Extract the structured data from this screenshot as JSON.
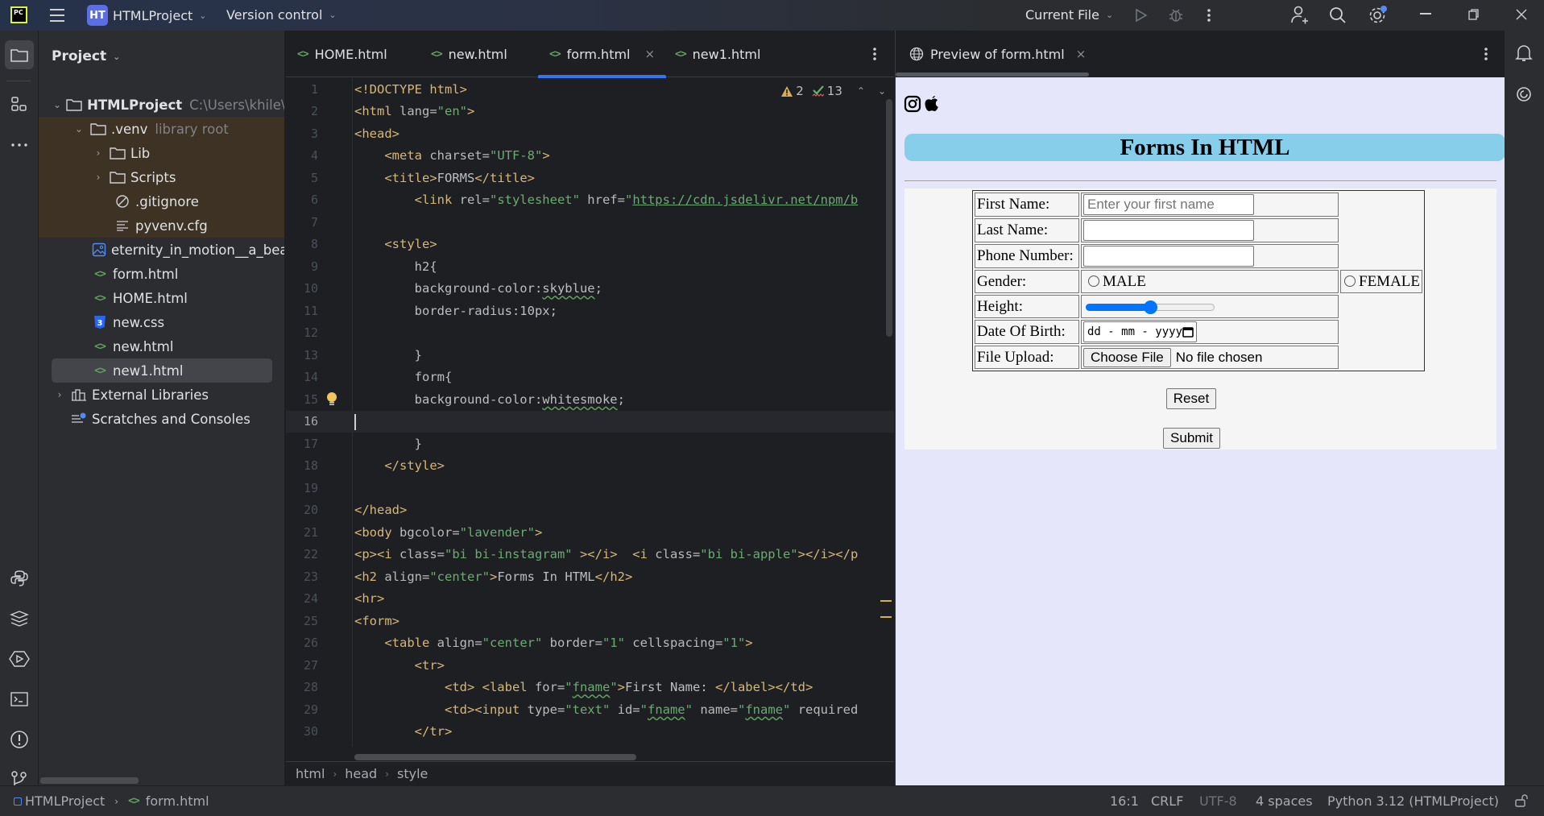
{
  "titlebar": {
    "app_logo": "PC",
    "project_badge": "HT",
    "project_name": "HTMLProject",
    "vcs_label": "Version control",
    "run_config": "Current File",
    "icons": [
      "main-menu-icon",
      "run-icon",
      "debug-icon",
      "more-icon",
      "add-user-icon",
      "search-icon",
      "settings-icon",
      "minimize-icon",
      "restore-icon",
      "close-icon"
    ]
  },
  "left_strip": {
    "top": [
      "folder-icon",
      "structure-icon",
      "more-icon"
    ],
    "bottom": [
      "python-console-icon",
      "layers-icon",
      "services-icon",
      "terminal-icon",
      "problems-icon",
      "git-icon"
    ]
  },
  "project_panel": {
    "title": "Project",
    "tree": [
      {
        "label": "HTMLProject",
        "hint": "C:\\Users\\khile\\F",
        "type": "folder",
        "expanded": true
      },
      {
        "label": ".venv",
        "hint": "library root",
        "type": "folder",
        "expanded": true
      },
      {
        "label": "Lib",
        "type": "folder",
        "expanded": false
      },
      {
        "label": "Scripts",
        "type": "folder",
        "expanded": false
      },
      {
        "label": ".gitignore",
        "type": "ignore"
      },
      {
        "label": "pyvenv.cfg",
        "type": "text"
      },
      {
        "label": "eternity_in_motion__a_beach",
        "type": "image"
      },
      {
        "label": "form.html",
        "type": "html"
      },
      {
        "label": "HOME.html",
        "type": "html"
      },
      {
        "label": "new.css",
        "type": "css"
      },
      {
        "label": "new.html",
        "type": "html"
      },
      {
        "label": "new1.html",
        "type": "html",
        "selected": true
      },
      {
        "label": "External Libraries",
        "type": "library",
        "expanded": false
      },
      {
        "label": "Scratches and Consoles",
        "type": "scratches"
      }
    ]
  },
  "editor": {
    "tabs": [
      {
        "label": "HOME.html"
      },
      {
        "label": "new.html"
      },
      {
        "label": "form.html",
        "active": true
      },
      {
        "label": "new1.html"
      }
    ],
    "warnings": "2",
    "typos": "13",
    "current_line": 16,
    "breadcrumb": [
      "html",
      "head",
      "style"
    ]
  },
  "preview": {
    "tab_label": "Preview of form.html",
    "heading": "Forms In HTML",
    "labels": {
      "first_name": "First Name:",
      "last_name": "Last Name:",
      "phone": "Phone Number:",
      "gender": "Gender:",
      "height": "Height:",
      "dob": "Date Of Birth:",
      "file": "File Upload:"
    },
    "first_name_placeholder": "Enter your first name",
    "gender_options": [
      "MALE",
      "FEMALE"
    ],
    "height_slider_fraction": 0.5,
    "dob_placeholder": "dd - mm - yyyy",
    "choose_file_label": "Choose File",
    "no_file_text": "No file chosen",
    "reset_label": "Reset",
    "submit_label": "Submit",
    "colors": {
      "page_bg": "#e6e6fa",
      "heading_bg": "#87ceeb",
      "form_bg": "#f5f5f5",
      "slider": "#0075ff"
    }
  },
  "statusbar": {
    "project": "HTMLProject",
    "file": "form.html",
    "position": "16:1",
    "line_ending": "CRLF",
    "encoding": "UTF-8",
    "indent": "4 spaces",
    "interpreter": "Python 3.12 (HTMLProject)"
  }
}
